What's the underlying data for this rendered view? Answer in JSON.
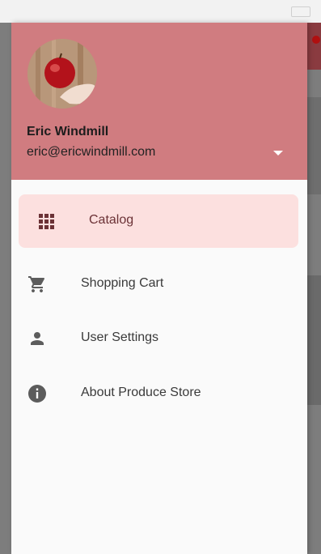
{
  "user": {
    "name": "Eric Windmill",
    "email": "eric@ericwindmill.com"
  },
  "menu": {
    "items": [
      {
        "label": "Catalog",
        "icon": "grid-icon",
        "selected": true
      },
      {
        "label": "Shopping Cart",
        "icon": "shopping-cart-icon",
        "selected": false
      },
      {
        "label": "User Settings",
        "icon": "person-icon",
        "selected": false
      },
      {
        "label": "About Produce Store",
        "icon": "info-icon",
        "selected": false
      }
    ]
  },
  "colors": {
    "header": "#d07c80",
    "selected_bg": "#fce0df",
    "selected_text": "#6b3236",
    "icon": "#5c5c5c",
    "drawer_bg": "#fafafa"
  }
}
